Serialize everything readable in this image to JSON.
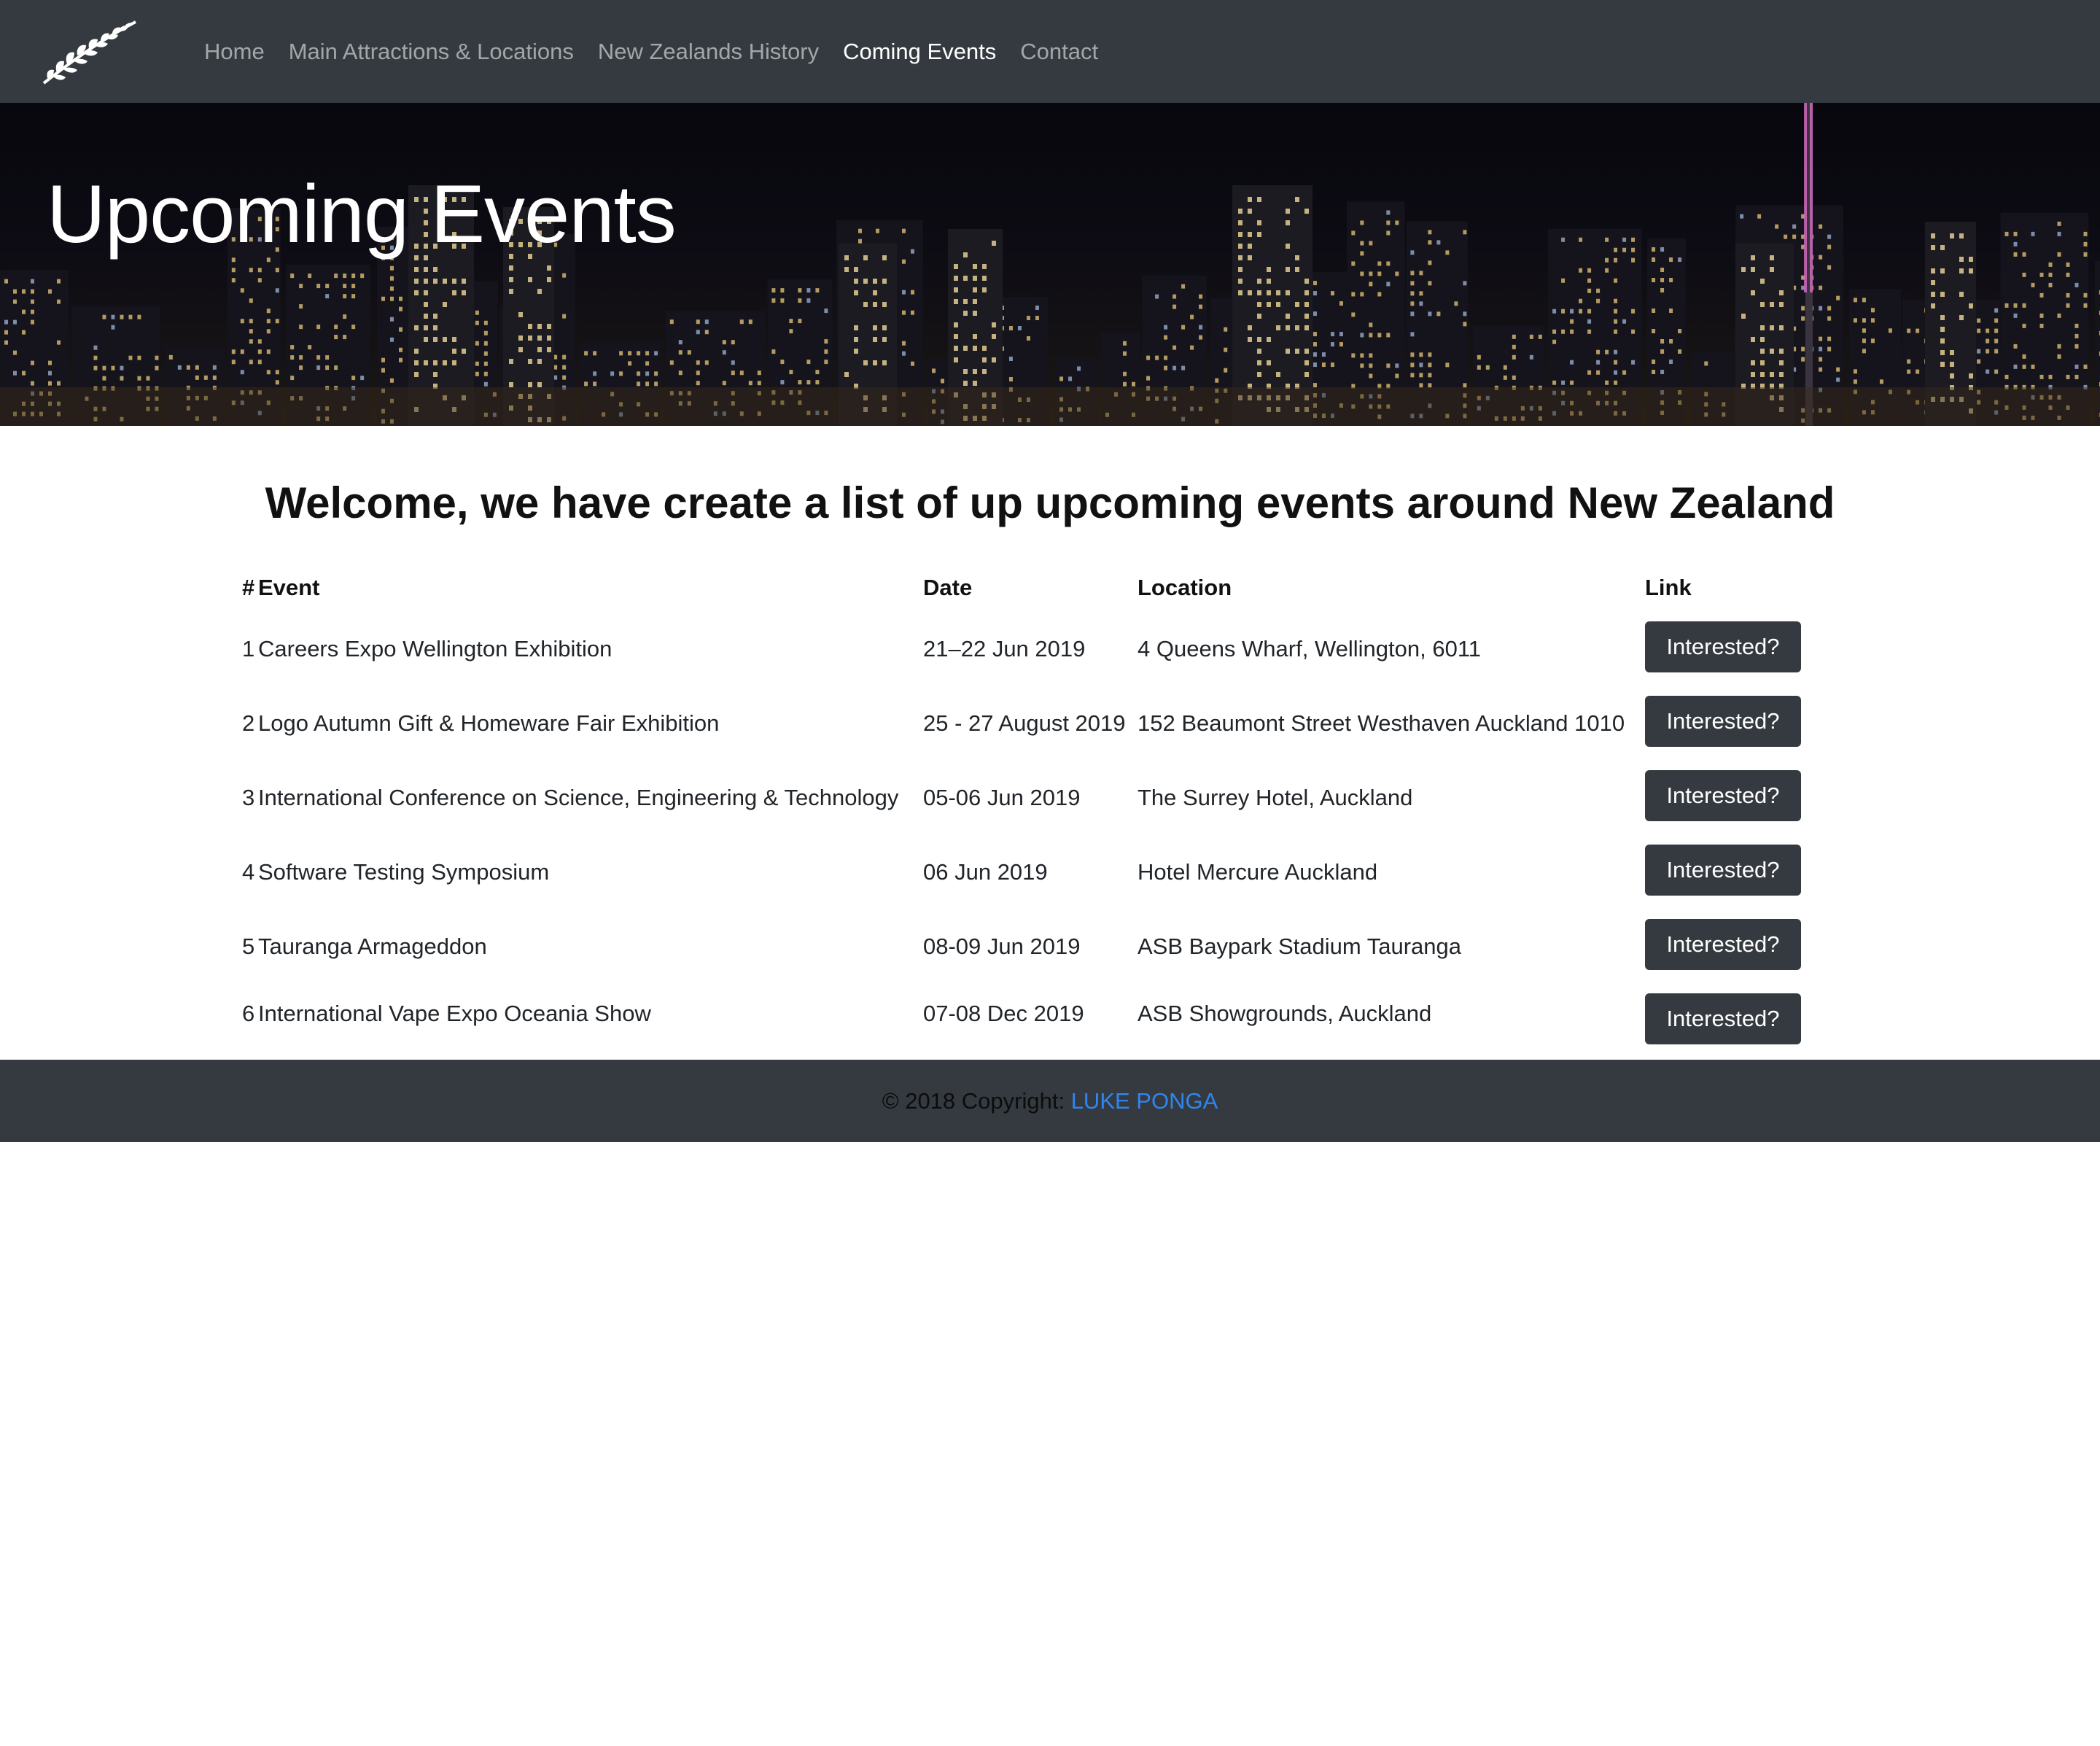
{
  "nav": {
    "logo_icon": "silver-fern-icon",
    "items": [
      {
        "label": "Home",
        "active": false
      },
      {
        "label": "Main Attractions & Locations",
        "active": false
      },
      {
        "label": "New Zealands History",
        "active": false
      },
      {
        "label": "Coming Events",
        "active": true
      },
      {
        "label": "Contact",
        "active": false
      }
    ]
  },
  "hero": {
    "title": "Upcoming Events"
  },
  "main": {
    "heading": "Welcome, we have create a list of up upcoming events around New Zealand",
    "table": {
      "headers": {
        "num": "#",
        "event": "Event",
        "date": "Date",
        "location": "Location",
        "link": "Link"
      },
      "rows": [
        {
          "num": "1",
          "event": "Careers Expo Wellington Exhibition",
          "date": "21–22 Jun 2019",
          "location": "4 Queens Wharf, Wellington, 6011",
          "button": "Interested?"
        },
        {
          "num": "2",
          "event": "Logo Autumn Gift & Homeware Fair Exhibition",
          "date": "25 - 27 August 2019",
          "location": "152 Beaumont Street Westhaven Auckland 1010",
          "button": "Interested?"
        },
        {
          "num": "3",
          "event": "International Conference on Science, Engineering & Technology",
          "date": "05-06 Jun 2019",
          "location": "The Surrey Hotel, Auckland",
          "button": "Interested?"
        },
        {
          "num": "4",
          "event": "Software Testing Symposium",
          "date": "06 Jun 2019",
          "location": "Hotel Mercure Auckland",
          "button": "Interested?"
        },
        {
          "num": "5",
          "event": "Tauranga Armageddon",
          "date": "08-09 Jun 2019",
          "location": "ASB Baypark Stadium Tauranga",
          "button": "Interested?"
        },
        {
          "num": "6",
          "event": "International Vape Expo Oceania Show",
          "date": "07-08 Dec 2019",
          "location": "ASB Showgrounds, Auckland",
          "button": "Interested?"
        }
      ]
    }
  },
  "footer": {
    "text": "© 2018 Copyright: ",
    "link": "LUKE PONGA"
  },
  "colors": {
    "navbar_bg": "#343a40",
    "button_bg": "#343a40",
    "footer_link": "#2f86f0"
  }
}
